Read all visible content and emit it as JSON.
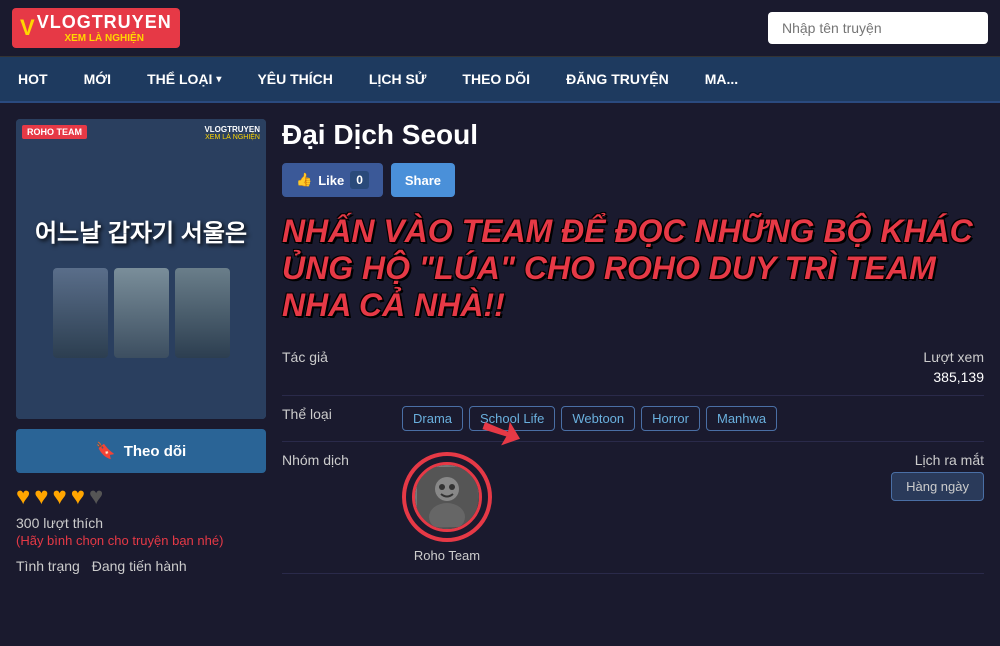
{
  "header": {
    "logo_main": "VLOGTRUYEN",
    "logo_sub": "XEM LÀ NGHIỆN",
    "search_placeholder": "Nhập tên truyện"
  },
  "nav": {
    "items": [
      {
        "label": "HOT",
        "id": "hot"
      },
      {
        "label": "MỚI",
        "id": "moi"
      },
      {
        "label": "THỂ LOẠI",
        "id": "theloai",
        "dropdown": true
      },
      {
        "label": "YÊU THÍCH",
        "id": "yeuthich"
      },
      {
        "label": "LỊCH SỬ",
        "id": "lichsu"
      },
      {
        "label": "THEO DÕI",
        "id": "theodoi"
      },
      {
        "label": "ĐĂNG TRUYỆN",
        "id": "dangtuyen"
      },
      {
        "label": "MA...",
        "id": "ma"
      }
    ]
  },
  "manga": {
    "title": "Đại Dịch Seoul",
    "cover_badge": "ROHO TEAM",
    "cover_watermark": "VLOGTRUYEN",
    "cover_watermark_sub": "XEM LÀ NGHIỆN",
    "cover_title_kr": "어느날 갑자기 서울은",
    "like_count": "0",
    "like_label": "Like",
    "share_label": "Share",
    "overlay_text": "NHẤN VÀO TEAM ĐỂ ĐỌC NHỮNG BỘ KHÁC ỦNG HỘ \"LÚA\" CHO ROHO DUY TRÌ TEAM NHA CẢ NHÀ!!",
    "author_label": "Tác giả",
    "author_value": "",
    "views_label": "Lượt xem",
    "views_value": "385,139",
    "genre_label": "Thể loại",
    "genres": [
      "Drama",
      "School Life",
      "Webtoon",
      "Horror",
      "Manhwa"
    ],
    "group_label": "Nhóm dịch",
    "group_name": "Roho Team",
    "release_label": "Lịch ra mắt",
    "release_value": "Hàng ngày",
    "follow_label": "Theo dõi",
    "stars": [
      "♥",
      "♥",
      "♥",
      "♥"
    ],
    "vote_count": "300 lượt thích",
    "vote_hint": "(Hãy bình chọn cho truyện bạn nhé)",
    "status_label": "Tình trạng",
    "status_value": "Đang tiến hành"
  }
}
